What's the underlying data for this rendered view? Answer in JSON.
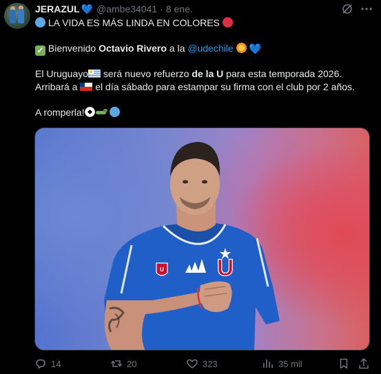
{
  "author": {
    "name": "JERAZUL",
    "handle": "@ambe34041",
    "separator": "·",
    "date": "8 ene."
  },
  "tweet": {
    "line1": "LA VIDA ES MÁS LINDA EN COLORES",
    "line2": {
      "prefix": "Bienvenido ",
      "name": "Octavio Rivero",
      "middle": " a la ",
      "mention": "@udechile"
    },
    "line3": {
      "prefix": "El Uruguayo",
      "middle": " será nuevo refuerzo ",
      "bold": "de la U",
      "suffix": " para esta temporada 2026."
    },
    "line4": {
      "prefix": "Arribará a ",
      "suffix": " el día sábado para estampar su firma con el club por 2 años."
    },
    "line5": "A romperla!"
  },
  "media": {
    "icon": "player-photo",
    "jersey_letter": "U",
    "colors": {
      "jersey": "#1f5fc7",
      "background_left": "#5474cf",
      "background_right": "#d9605f"
    }
  },
  "actions": {
    "replies": "14",
    "reposts": "20",
    "likes": "323",
    "views": "35 mil"
  },
  "colors": {
    "background": "#000000",
    "text": "#e7e9ea",
    "secondary": "#71767b",
    "mention": "#1d9bf0"
  }
}
